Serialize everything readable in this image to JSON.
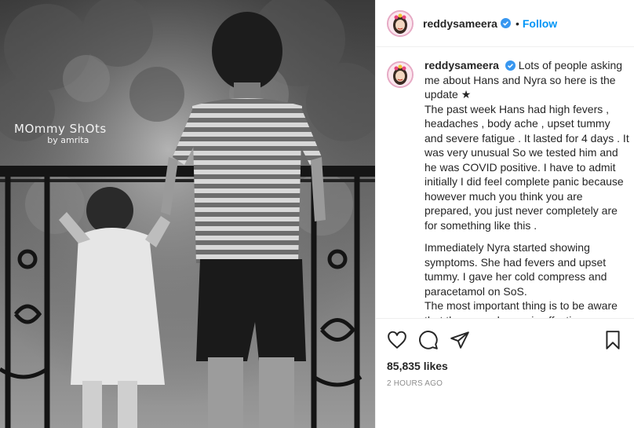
{
  "post": {
    "username": "reddysameera",
    "follow_label": "Follow",
    "separator": "•",
    "watermark_line1": "MOmmy ShOts",
    "watermark_line2": "by amrita"
  },
  "caption": {
    "username": "reddysameera",
    "paragraph1": "Lots of people asking me about Hans and Nyra so here is the update ★\nThe past week Hans had high fevers , headaches , body ache , upset tummy and severe fatigue . It lasted for 4 days . It was very unusual So we tested him and he was COVID positive. I have to admit initially I did feel complete panic because however much you think you are prepared, you just never completely are for something like this .",
    "paragraph2": "Immediately Nyra started showing symptoms. She had fevers and upset tummy. I gave her cold compress and paracetamol on SoS.\nThe most important thing is to be aware that the second wave is affecting many children but doctors"
  },
  "stats": {
    "likes": "85,835 likes",
    "time": "2 HOURS AGO"
  },
  "icons": {
    "like": "heart-icon",
    "comment": "comment-icon",
    "share": "share-icon",
    "save": "bookmark-icon",
    "verified": "verified-badge-icon"
  },
  "colors": {
    "follow": "#0095f6",
    "verified": "#3897f0",
    "text": "#262626",
    "muted": "#8e8e8e"
  }
}
